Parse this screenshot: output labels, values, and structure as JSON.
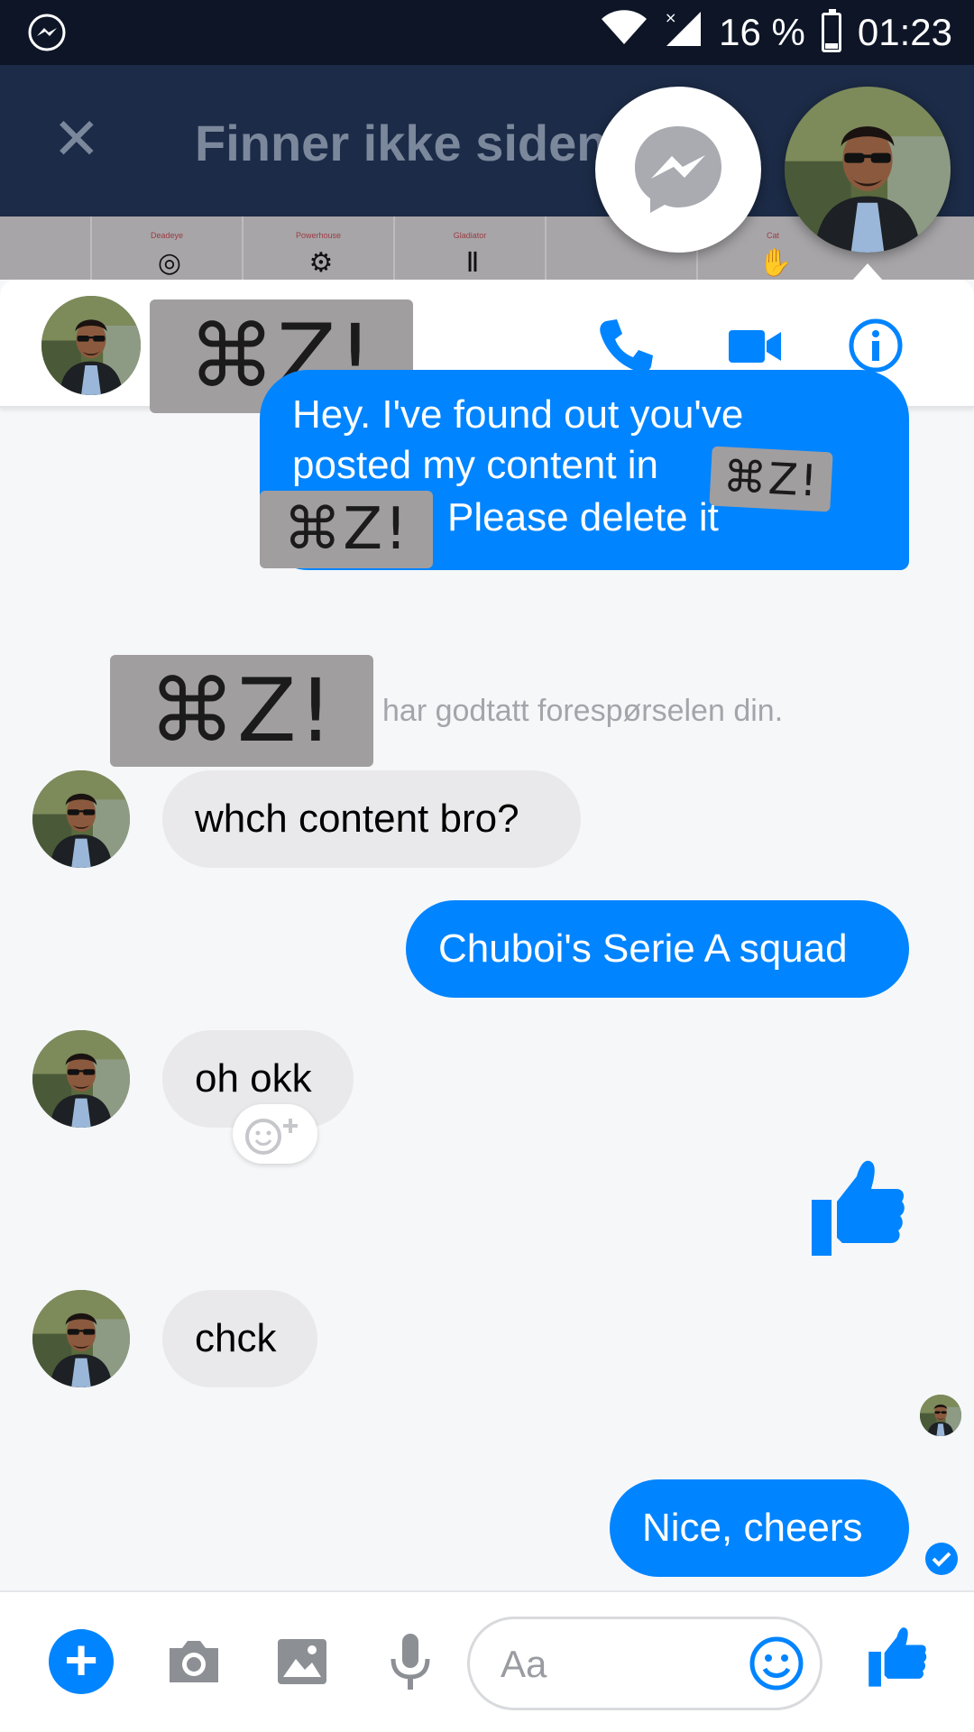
{
  "status_bar": {
    "battery": "16 %",
    "time": "01:23"
  },
  "background_page": {
    "title": "Finner ikke siden",
    "strip_labels": [
      "Deadeye",
      "Powerhouse",
      "Gladiator",
      "",
      "Cat"
    ]
  },
  "chat": {
    "contact_name_redacted": "⌘Z!",
    "messages": [
      {
        "direction": "out",
        "text_before": "Hey. I've found out you've",
        "text_line2": "posted my content in",
        "redacted": "⌘Z!",
        "text_after": "Please delete it"
      },
      {
        "direction": "in",
        "text": "whch content bro?"
      },
      {
        "direction": "out",
        "text": "Chuboi's Serie A squad"
      },
      {
        "direction": "in",
        "text": "oh okk"
      },
      {
        "direction": "in",
        "text": "chck"
      },
      {
        "direction": "out",
        "text": "Nice, cheers"
      }
    ],
    "system_redacted": "⌘Z!",
    "system_text": "har godtatt forespørselen din."
  },
  "composer": {
    "placeholder": "Aa"
  },
  "colors": {
    "accent": "#0084ff",
    "status_bar": "#0d1527",
    "incoming_bubble": "#e9e9eb"
  },
  "icons": {
    "status_left": "messenger-icon",
    "topbar": [
      "phone-icon",
      "video-camera-icon",
      "info-icon"
    ],
    "composer": [
      "plus-icon",
      "camera-icon",
      "image-icon",
      "microphone-icon",
      "emoji-icon",
      "thumbs-up-icon"
    ]
  }
}
